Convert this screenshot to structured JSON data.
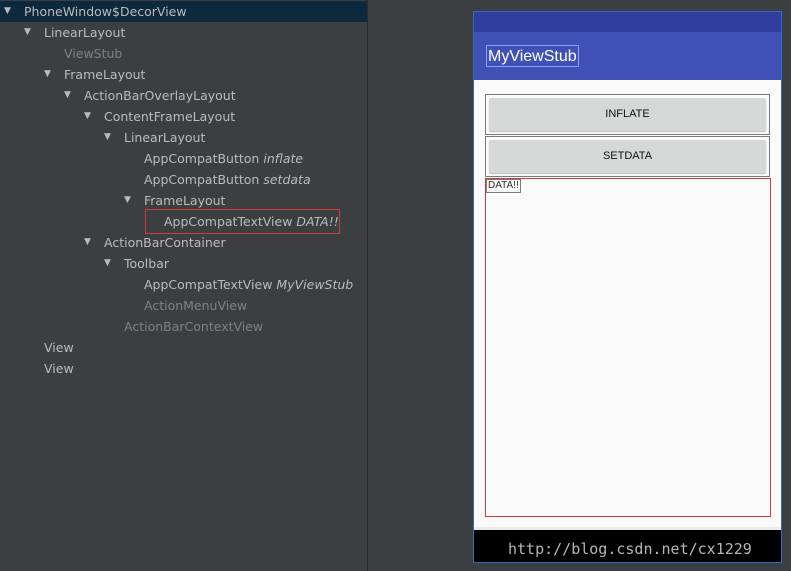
{
  "tree": {
    "nodes": [
      {
        "label": "PhoneWindow$DecorView",
        "hint": "",
        "expanded": true
      },
      {
        "label": "LinearLayout",
        "hint": "",
        "expanded": true
      },
      {
        "label": "ViewStub",
        "hint": "",
        "expanded": false
      },
      {
        "label": "FrameLayout",
        "hint": "",
        "expanded": true
      },
      {
        "label": "ActionBarOverlayLayout",
        "hint": "",
        "expanded": true
      },
      {
        "label": "ContentFrameLayout",
        "hint": "",
        "expanded": true
      },
      {
        "label": "LinearLayout",
        "hint": "",
        "expanded": true
      },
      {
        "label": "AppCompatButton",
        "hint": "inflate",
        "expanded": false
      },
      {
        "label": "AppCompatButton",
        "hint": "setdata",
        "expanded": false
      },
      {
        "label": "FrameLayout",
        "hint": "",
        "expanded": true
      },
      {
        "label": "AppCompatTextView",
        "hint": "DATA!!",
        "expanded": false
      },
      {
        "label": "ActionBarContainer",
        "hint": "",
        "expanded": true
      },
      {
        "label": "Toolbar",
        "hint": "",
        "expanded": true
      },
      {
        "label": "AppCompatTextView",
        "hint": "MyViewStub",
        "expanded": false
      },
      {
        "label": "ActionMenuView",
        "hint": "",
        "expanded": false
      },
      {
        "label": "ActionBarContextView",
        "hint": "",
        "expanded": false
      },
      {
        "label": "View",
        "hint": "",
        "expanded": false
      },
      {
        "label": "View",
        "hint": "",
        "expanded": false
      }
    ]
  },
  "device": {
    "toolbar_title": "MyViewStub",
    "inflate_button": "INFLATE",
    "setdata_button": "SETDATA",
    "data_text": "DATA!!"
  },
  "watermark": "http://blog.csdn.net/cx1229",
  "colors": {
    "primary": "#3f51b5",
    "primary_dark": "#303f9f",
    "selection_border": "#d03c3c",
    "tree_background": "#3c3f41",
    "tree_selected_row": "#0d293e"
  }
}
